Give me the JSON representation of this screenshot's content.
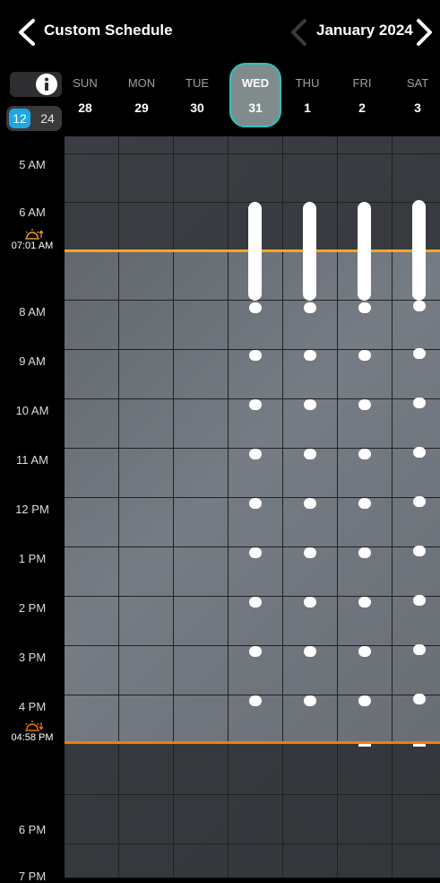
{
  "header": {
    "back_icon": "chevron-left-icon",
    "title": "Custom Schedule",
    "month": "January 2024",
    "prev_icon": "chevron-left-icon",
    "next_icon": "chevron-right-icon"
  },
  "controls": {
    "info_icon": "info-icon",
    "format_12": "12",
    "format_24": "24",
    "selected_format": "12"
  },
  "days": [
    {
      "name": "SUN",
      "date": "28"
    },
    {
      "name": "MON",
      "date": "29"
    },
    {
      "name": "TUE",
      "date": "30"
    },
    {
      "name": "WED",
      "date": "31",
      "selected": true
    },
    {
      "name": "THU",
      "date": "1"
    },
    {
      "name": "FRI",
      "date": "2"
    },
    {
      "name": "SAT",
      "date": "3"
    }
  ],
  "hours": [
    "5 AM",
    "6 AM",
    "8 AM",
    "9 AM",
    "10 AM",
    "11 AM",
    "12 PM",
    "1 PM",
    "2 PM",
    "3 PM",
    "4 PM",
    "6 PM",
    "7 PM"
  ],
  "sunrise": {
    "time": "07:01 AM",
    "icon": "sunrise-icon",
    "color": "#f5a623"
  },
  "sunset": {
    "time": "04:58 PM",
    "icon": "sunset-icon",
    "color": "#ff7a00"
  },
  "colors": {
    "selected_day_border": "#31c2bd",
    "format_active": "#1ca8e4"
  }
}
